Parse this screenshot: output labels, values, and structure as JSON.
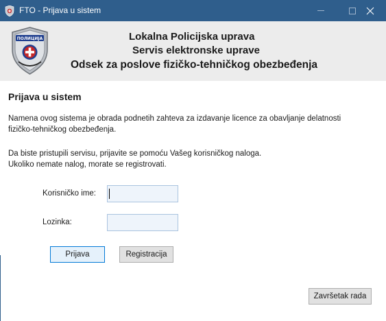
{
  "window": {
    "title": "FTO - Prijava u sistem",
    "titlebar_color": "#2f5e8c",
    "controls": [
      "minimize",
      "maximize",
      "close"
    ]
  },
  "header": {
    "line1": "Lokalna Policijska uprava",
    "line2": "Servis elektronske uprave",
    "line3": "Odsek za poslove fizičko-tehničkog obezbeđenja",
    "emblem_text": "ПОЛИЦИЈА"
  },
  "main": {
    "section_title": "Prijava u sistem",
    "paragraph1_line1": "Namena ovog sistema je obrada podnetih zahteva za izdavanje licence za obavljanje delatnosti",
    "paragraph1_line2": "fizičko-tehničkog obezbeđenja.",
    "paragraph2_line1": "Da biste pristupili servisu, prijavite se pomoću Vašeg korisničkog naloga.",
    "paragraph2_line2": "Ukoliko nemate nalog, morate se registrovati."
  },
  "form": {
    "username_label": "Korisničko ime:",
    "username_value": "",
    "password_label": "Lozinka:",
    "password_value": "",
    "login_button": "Prijava",
    "register_button": "Registracija"
  },
  "footer": {
    "exit_button": "Završetak rada"
  }
}
